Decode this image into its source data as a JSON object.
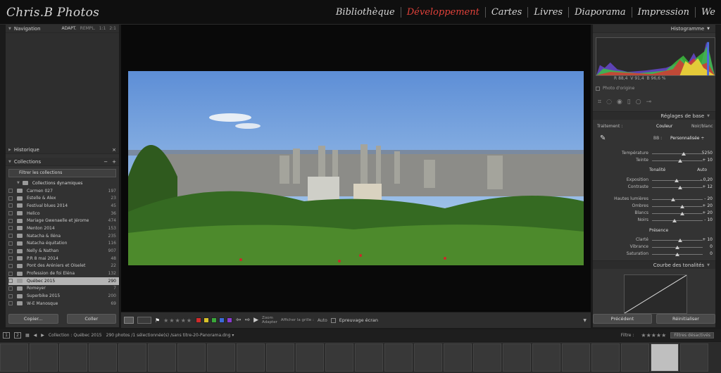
{
  "app": {
    "title": "Chris.B Photos"
  },
  "modules": [
    "Bibliothèque",
    "Développement",
    "Cartes",
    "Livres",
    "Diaporama",
    "Impression",
    "We"
  ],
  "active_module": "Développement",
  "left_panel": {
    "navigation": {
      "title": "Navigation",
      "options": [
        "ADAPT.",
        "REMPL.",
        "1:1",
        "2:1"
      ]
    },
    "historique": {
      "title": "Historique",
      "close": "×"
    },
    "collections": {
      "title": "Collections",
      "actions": [
        "−",
        "+"
      ]
    },
    "filter_placeholder": "Filtrer les collections",
    "dynamic_title": "Collections dynamiques",
    "items": [
      {
        "name": "Carmen 027",
        "count": "197"
      },
      {
        "name": "Estelle & Alex",
        "count": "23"
      },
      {
        "name": "Festival blues 2014",
        "count": "45"
      },
      {
        "name": "Helico",
        "count": "36"
      },
      {
        "name": "Mariage Gwenaelle et Jérome",
        "count": "474"
      },
      {
        "name": "Menton 2014",
        "count": "153"
      },
      {
        "name": "Natacha & Iléna",
        "count": "235"
      },
      {
        "name": "Natacha équitation",
        "count": "116"
      },
      {
        "name": "Nelly & Nathan",
        "count": "907"
      },
      {
        "name": "P.R 8 mai 2014",
        "count": "48"
      },
      {
        "name": "Pont des Aréniers et Oiselet",
        "count": "22"
      },
      {
        "name": "Profession de foi Eléna",
        "count": "132"
      },
      {
        "name": "Québec 2015",
        "count": "290",
        "selected": true
      },
      {
        "name": "Romeyer",
        "count": "7"
      },
      {
        "name": "Superbike 2015",
        "count": "200"
      },
      {
        "name": "W-E Manosque",
        "count": "69"
      }
    ],
    "copy_button": "Copier...",
    "paste_button": "Coller"
  },
  "toolbar": {
    "stars": "★★★★★",
    "zoom_label": "Zoom",
    "zoom_value": "Adapter",
    "grid_label": "Afficher la grille :",
    "grid_value": "Auto",
    "softproof_label": "Epreuvage écran",
    "swatches": [
      "#d02a2a",
      "#d8c22a",
      "#3aa83a",
      "#3a6ad8",
      "#8a3ad0"
    ]
  },
  "right_panel": {
    "histogram": {
      "title": "Histogramme",
      "r_label": "R",
      "r": "88,4",
      "v_label": "V",
      "v": "91,4",
      "b_label": "B",
      "b": "96,6",
      "pct": "%",
      "photo_origine": "Photo d'origine"
    },
    "basic": {
      "title": "Réglages de base",
      "traitement_label": "Traitement :",
      "couleur": "Couleur",
      "noir_blanc": "Noir/blanc",
      "bb_label": "BB :",
      "bb_value": "Personnalisée ÷",
      "temperature_label": "Température",
      "temperature": "5250",
      "teinte_label": "Teinte",
      "teinte": "+ 10",
      "tonalite_label": "Tonalité",
      "auto_label": "Auto",
      "exposition_label": "Exposition",
      "exposition": "- 0,20",
      "contraste_label": "Contraste",
      "contraste": "+ 12",
      "hautes_label": "Hautes lumières",
      "hautes": "- 20",
      "ombres_label": "Ombres",
      "ombres": "+ 20",
      "blancs_label": "Blancs",
      "blancs": "+ 20",
      "noirs_label": "Noirs",
      "noirs": "- 10",
      "presence_label": "Présence",
      "clarte_label": "Clarté",
      "clarte": "+ 10",
      "vibrance_label": "Vibrance",
      "vibrance": "0",
      "saturation_label": "Saturation",
      "saturation": "0"
    },
    "tone_curve": {
      "title": "Courbe des tonalités"
    },
    "previous_button": "Précédent",
    "reset_button": "Réinitialiser"
  },
  "filmstrip_bar": {
    "pages": [
      "1",
      "2"
    ],
    "collection": "Collection : Québec 2015",
    "count": "290 photos /1 sélectionnée(s) /sans titre-20-Panorama.dng ▾",
    "filter_label": "Filtre :",
    "filter_value": "Filtres désactivés"
  }
}
